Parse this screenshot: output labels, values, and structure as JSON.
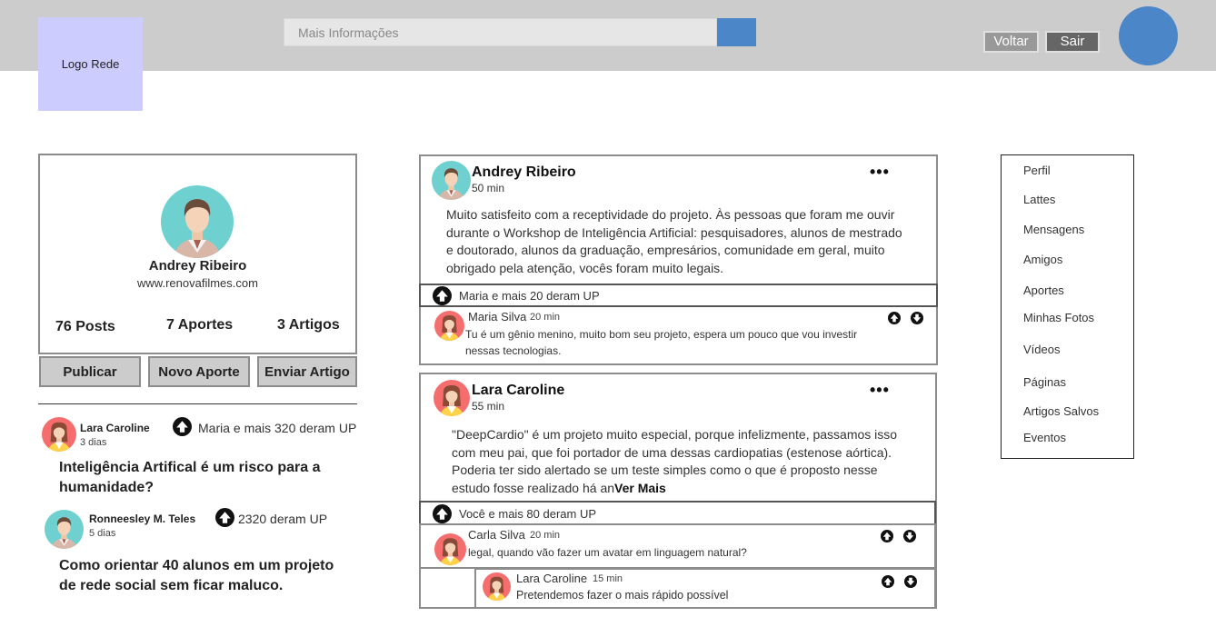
{
  "header": {
    "logo_label": "Logo Rede",
    "search_placeholder": "Mais Informações",
    "back_label": "Voltar",
    "exit_label": "Sair"
  },
  "profile": {
    "name": "Andrey Ribeiro",
    "website": "www.renovafilmes.com",
    "posts_label": "76 Posts",
    "aportes_label": "7 Aportes",
    "artigos_label": "3 Artigos"
  },
  "actions": {
    "publish_label": "Publicar",
    "new_aporte_label": "Novo Aporte",
    "send_article_label": "Enviar Artigo"
  },
  "left_feed": [
    {
      "author": "Lara Caroline",
      "time": "3 dias",
      "ups": "Maria e mais 320 deram UP",
      "title_line1": "Inteligência Artifical é um risco para a",
      "title_line2": "humanidade?"
    },
    {
      "author": "Ronneesley M. Teles",
      "time": "5 dias",
      "ups": "2320 deram UP",
      "title_line1": "Como orientar 40 alunos em um projeto",
      "title_line2": "de rede social sem ficar maluco."
    }
  ],
  "posts": [
    {
      "author": "Andrey Ribeiro",
      "time": "50 min",
      "text_lines": [
        "Muito satisfeito com a receptividade do projeto. Às pessoas que foram me ouvir",
        "durante o Workshop de Inteligência Artificial: pesquisadores, alunos de mestrado",
        "e doutorado, alunos da graduação, empresários, comunidade em geral, muito",
        "obrigado pela atenção, vocês foram muito legais."
      ],
      "ups": "Maria e mais 20 deram UP",
      "comments": [
        {
          "author": "Maria Silva",
          "time": "20 min",
          "text_line1": "Tu é um gênio menino, muito bom seu projeto, espera um pouco que vou investir",
          "text_line2": "nessas tecnologias."
        }
      ]
    },
    {
      "author": "Lara Caroline",
      "time": "55 min",
      "text_lines": [
        "\"DeepCardio\" é um projeto muito especial, porque infelizmente, passamos isso",
        "com meu pai, que foi portador de uma dessas cardiopatias (estenose aórtica).",
        "Poderia ter sido alertado se um teste simples como o que é proposto nesse",
        "estudo fosse realizado há an"
      ],
      "see_more": "Ver Mais",
      "ups": "Você e mais 80 deram UP",
      "comments": [
        {
          "author": "Carla Silva",
          "time": "20 min",
          "text_line1": "legal, quando vão fazer um avatar em linguagem natural?"
        },
        {
          "author": "Lara Caroline",
          "time": "15 min",
          "text_line1": "Pretendemos fazer o mais rápido possível"
        }
      ]
    }
  ],
  "menu": [
    "Perfil",
    "Lattes",
    "Mensagens",
    "Amigos",
    "Aportes",
    "Minhas Fotos",
    "Vídeos",
    "Páginas",
    "Artigos Salvos",
    "Eventos"
  ],
  "colors": {
    "header_bg": "#cccccc",
    "accent_blue": "#4a86c8",
    "logo_bg": "#ccccff",
    "button_gray": "#cccccc"
  }
}
